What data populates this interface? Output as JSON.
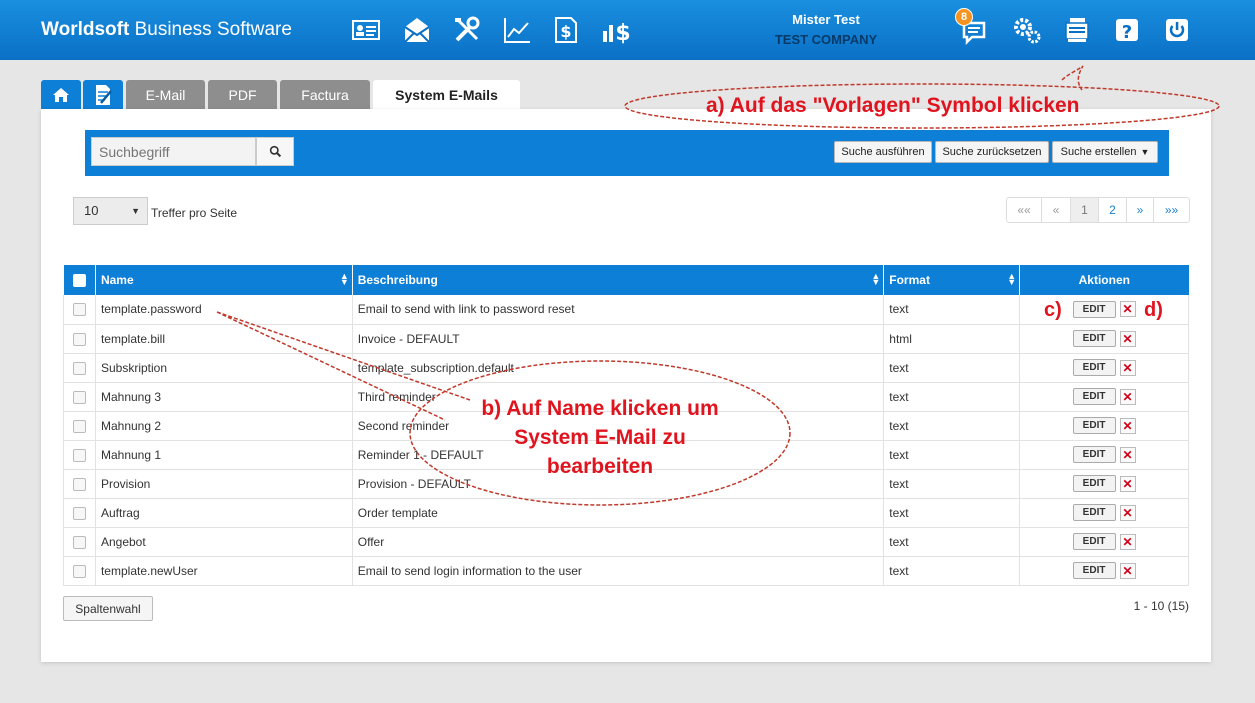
{
  "header": {
    "brand_bold": "Worldsoft",
    "brand_rest": " Business Software",
    "user_name": "Mister Test",
    "company": "TEST COMPANY",
    "notification_count": "8"
  },
  "tabs": [
    {
      "label": "E-Mail"
    },
    {
      "label": "PDF"
    },
    {
      "label": "Factura"
    },
    {
      "label": "System E-Mails"
    }
  ],
  "search": {
    "placeholder": "Suchbegriff",
    "run_label": "Suche ausführen",
    "reset_label": "Suche zurücksetzen",
    "create_label": "Suche erstellen"
  },
  "paging": {
    "per_page": "10",
    "per_page_label": "Treffer pro Seite",
    "first": "««",
    "prev": "«",
    "pages": [
      "1",
      "2"
    ],
    "next": "»",
    "last": "»»",
    "range": "1 - 10 (15)"
  },
  "table": {
    "columns": [
      "Name",
      "Beschreibung",
      "Format",
      "Aktionen"
    ],
    "edit_label": "EDIT",
    "delete_label": "✕",
    "rows": [
      {
        "name": "template.password",
        "desc": "Email to send with link to password reset",
        "format": "text"
      },
      {
        "name": "template.bill",
        "desc": "Invoice - DEFAULT",
        "format": "html"
      },
      {
        "name": "Subskription",
        "desc": "template_subscription.default",
        "format": "text"
      },
      {
        "name": "Mahnung 3",
        "desc": "Third reminder",
        "format": "text"
      },
      {
        "name": "Mahnung 2",
        "desc": "Second reminder",
        "format": "text"
      },
      {
        "name": "Mahnung 1",
        "desc": "Reminder 1 - DEFAULT",
        "format": "text"
      },
      {
        "name": "Provision",
        "desc": "Provision - DEFAULT",
        "format": "text"
      },
      {
        "name": "Auftrag",
        "desc": "Order template",
        "format": "text"
      },
      {
        "name": "Angebot",
        "desc": "Offer",
        "format": "text"
      },
      {
        "name": "template.newUser",
        "desc": "Email to send login information to the user",
        "format": "text"
      }
    ]
  },
  "column_select_label": "Spaltenwahl",
  "annotations": {
    "a": "a) Auf das \"Vorlagen\" Symbol klicken",
    "b1": "b) Auf Name klicken um",
    "b2": "System E-Mail zu",
    "b3": "bearbeiten",
    "c": "c)",
    "d": "d)"
  },
  "colors": {
    "header_blue": "#0e7fd6",
    "annotation_red": "#e0141e",
    "badge_orange": "#f6921e"
  }
}
